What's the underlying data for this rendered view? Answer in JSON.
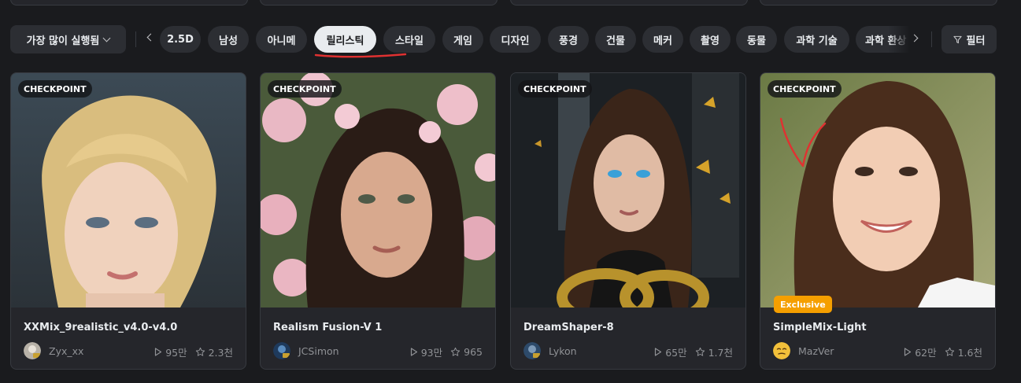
{
  "sort": {
    "label": "가장 많이 실행됨"
  },
  "tags": [
    {
      "label": "2.5D",
      "active": false
    },
    {
      "label": "남성",
      "active": false
    },
    {
      "label": "아니메",
      "active": false
    },
    {
      "label": "릴리스틱",
      "active": true
    },
    {
      "label": "스타일",
      "active": false
    },
    {
      "label": "게임",
      "active": false
    },
    {
      "label": "디자인",
      "active": false
    },
    {
      "label": "풍경",
      "active": false
    },
    {
      "label": "건물",
      "active": false
    },
    {
      "label": "메커",
      "active": false
    },
    {
      "label": "촬영",
      "active": false
    },
    {
      "label": "동물",
      "active": false
    },
    {
      "label": "과학 기술",
      "active": false
    },
    {
      "label": "과학 환상",
      "active": false
    }
  ],
  "filter": {
    "label": "필터"
  },
  "cards": [
    {
      "badge": "CHECKPOINT",
      "title": "XXMix_9realistic_v4.0-v4.0",
      "creator": "Zyx_xx",
      "runs": "95만",
      "stars": "2.3천",
      "exclusive": ""
    },
    {
      "badge": "CHECKPOINT",
      "title": "Realism Fusion-V 1",
      "creator": "JCSimon",
      "runs": "93만",
      "stars": "965",
      "exclusive": ""
    },
    {
      "badge": "CHECKPOINT",
      "title": "DreamShaper-8",
      "creator": "Lykon",
      "runs": "65만",
      "stars": "1.7천",
      "exclusive": ""
    },
    {
      "badge": "CHECKPOINT",
      "title": "SimpleMix-Light",
      "creator": "MazVer",
      "runs": "62만",
      "stars": "1.6천",
      "exclusive": "Exclusive"
    }
  ],
  "colors": {
    "background": "#1a1b1e",
    "chip": "#2c2e33",
    "active_chip": "#e9ecef",
    "card": "#25262b",
    "exclusive": "#f59f00",
    "annotation": "#e03131"
  },
  "icons": {
    "sort_toggle": "chevron-down-icon",
    "scroll_left": "chevron-left-icon",
    "scroll_right": "chevron-right-icon",
    "filter": "funnel-icon",
    "runs": "play-icon",
    "stars": "star-icon"
  }
}
